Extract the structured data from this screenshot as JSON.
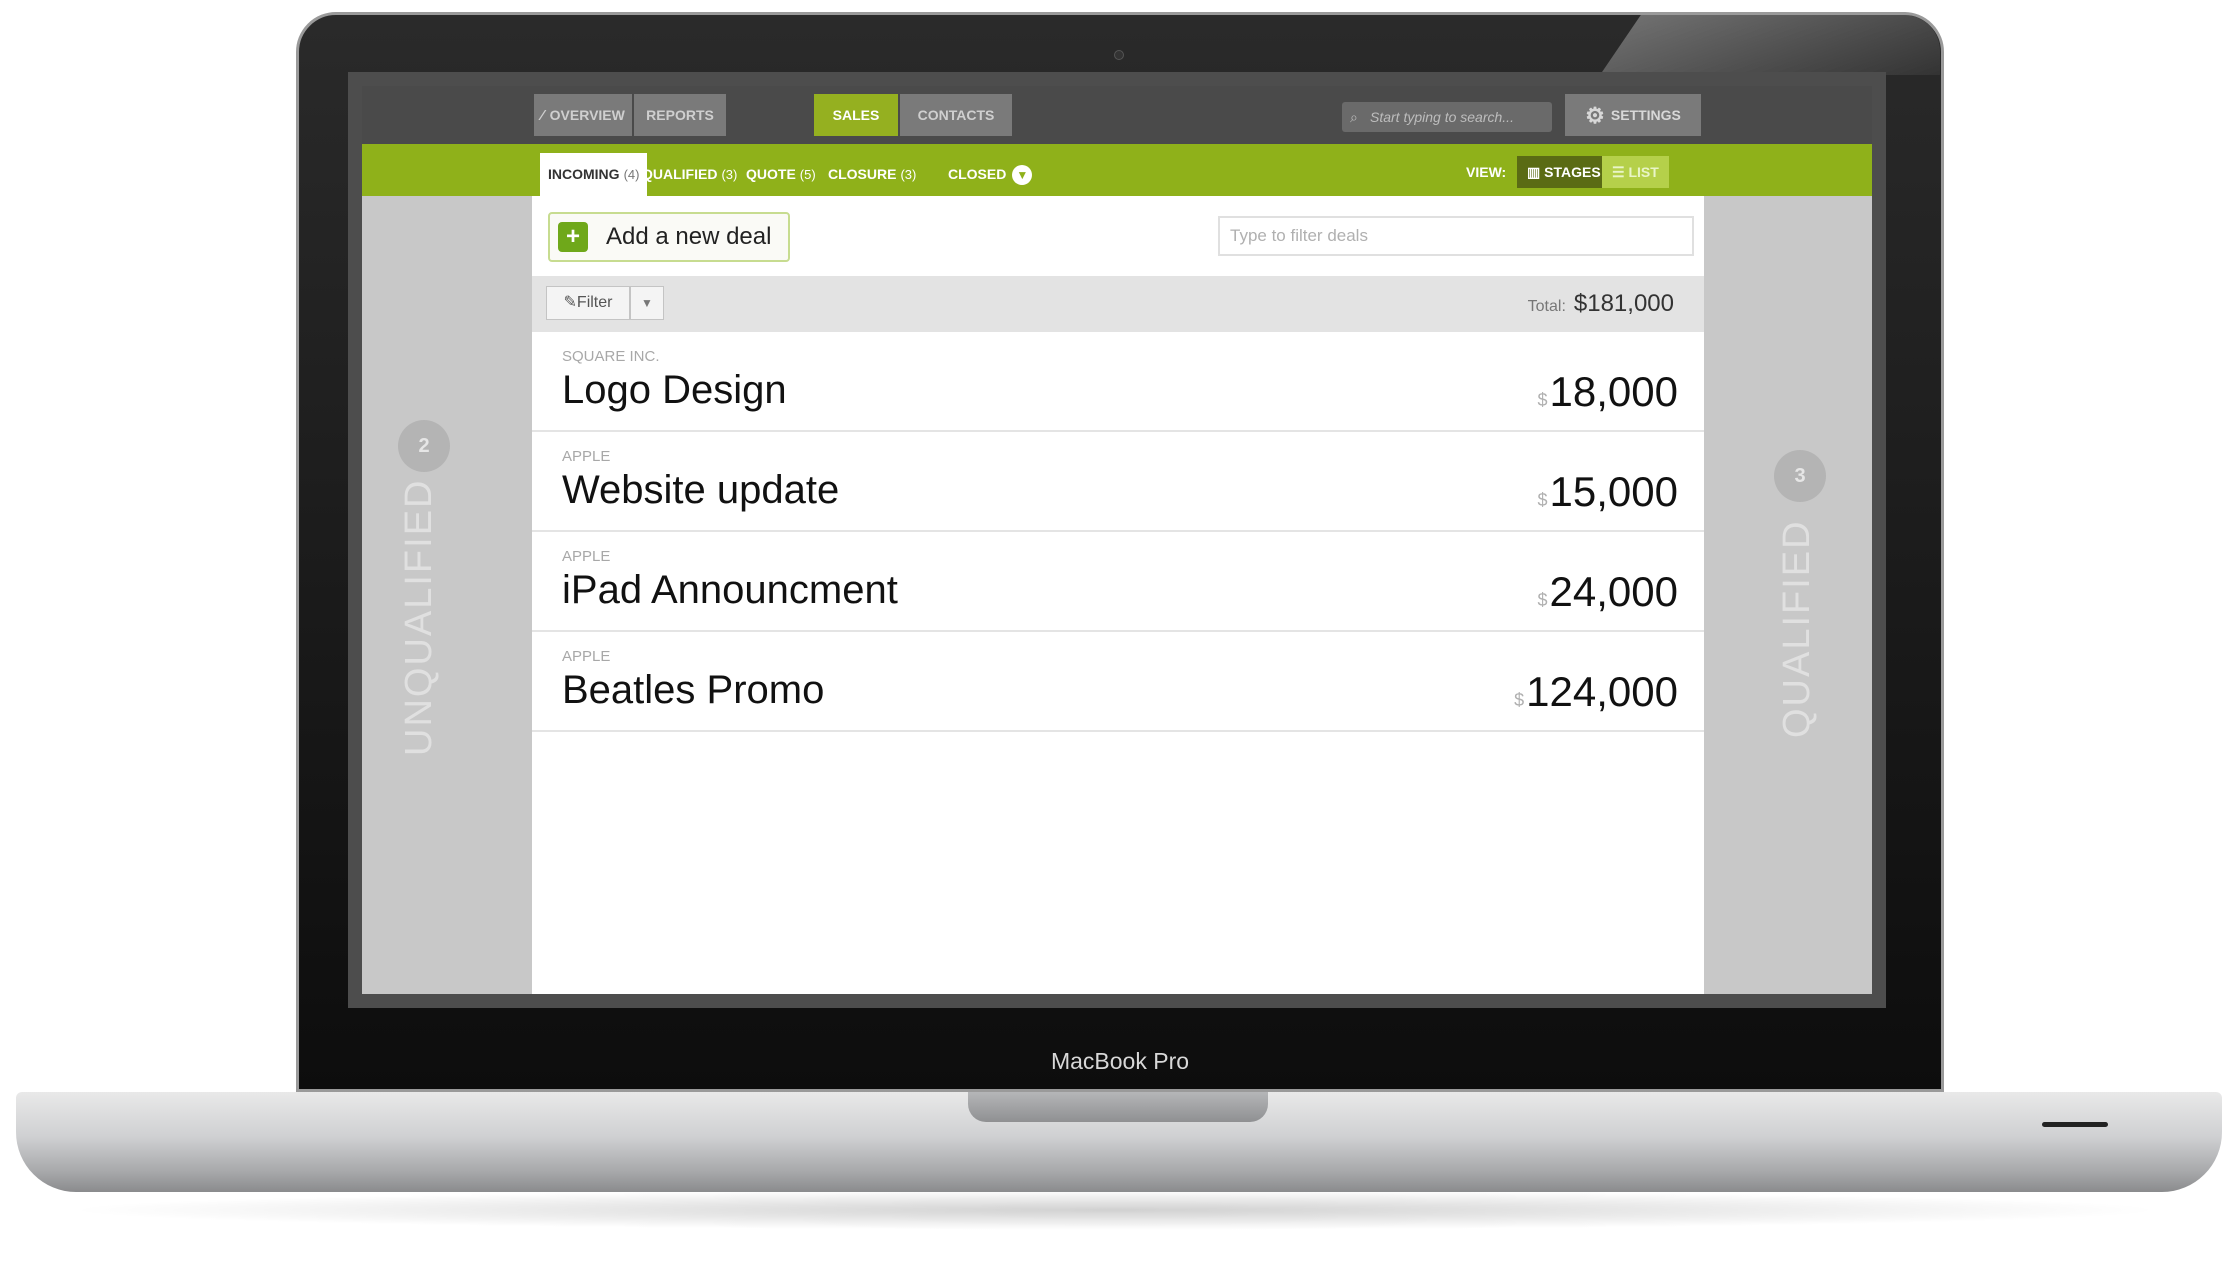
{
  "device": {
    "brand_label": "MacBook Pro"
  },
  "topnav": {
    "tabs": [
      {
        "label": "OVERVIEW",
        "icon": "chart-line-icon"
      },
      {
        "label": "REPORTS"
      },
      {
        "label": "SALES",
        "active": true
      },
      {
        "label": "CONTACTS"
      }
    ],
    "search_placeholder": "Start typing to search...",
    "settings_label": "SETTINGS"
  },
  "stages": [
    {
      "label": "INCOMING",
      "count": "(4)",
      "active": true
    },
    {
      "label": "QUALIFIED",
      "count": "(3)"
    },
    {
      "label": "QUOTE",
      "count": "(5)"
    },
    {
      "label": "CLOSURE",
      "count": "(3)"
    },
    {
      "label": "CLOSED"
    }
  ],
  "view": {
    "label": "VIEW:",
    "stages_label": "STAGES",
    "list_label": "LIST"
  },
  "left_column": {
    "count": "2",
    "label": "UNQUALIFIED"
  },
  "right_column": {
    "count": "3",
    "label": "QUALIFIED"
  },
  "actions": {
    "add_deal_label": "Add a new deal",
    "filter_placeholder": "Type to filter deals",
    "filter_label": "Filter"
  },
  "summary": {
    "total_label": "Total:",
    "total_value": "$181,000"
  },
  "deals": [
    {
      "company": "SQUARE INC.",
      "title": "Logo Design",
      "currency": "$",
      "amount": "18,000"
    },
    {
      "company": "APPLE",
      "title": "Website update",
      "currency": "$",
      "amount": "15,000"
    },
    {
      "company": "APPLE",
      "title": "iPad Announcment",
      "currency": "$",
      "amount": "24,000"
    },
    {
      "company": "APPLE",
      "title": "Beatles Promo",
      "currency": "$",
      "amount": "124,000"
    }
  ],
  "colors": {
    "accent_green": "#8fb11a",
    "dark_bar": "#4a4a4a",
    "side_gray": "#c8c8c8"
  }
}
